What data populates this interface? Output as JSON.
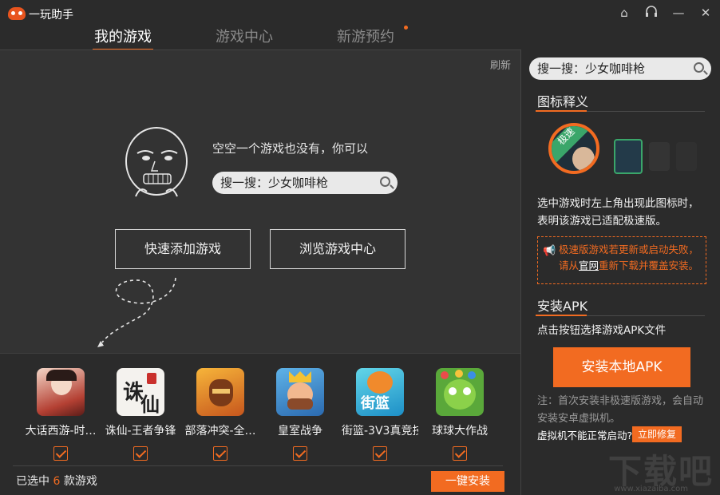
{
  "app": {
    "title": "一玩助手"
  },
  "tabs": [
    {
      "label": "我的游戏"
    },
    {
      "label": "游戏中心"
    },
    {
      "label": "新游预约"
    }
  ],
  "main": {
    "refresh": "刷新",
    "empty_text": "空空一个游戏也没有，你可以",
    "search_placeholder": "搜一搜：少女咖啡枪",
    "quick_add": "快速添加游戏",
    "browse_center": "浏览游戏中心"
  },
  "games": [
    {
      "name": "大话西游-时…",
      "checked": true
    },
    {
      "name": "诛仙-王者争锋",
      "checked": true
    },
    {
      "name": "部落冲突-全…",
      "checked": true
    },
    {
      "name": "皇室战争",
      "checked": true
    },
    {
      "name": "街篮-3V3真竞技",
      "checked": true
    },
    {
      "name": "球球大作战",
      "checked": true
    }
  ],
  "selection": {
    "prefix": "已选中",
    "count": "6",
    "suffix": "款游戏",
    "install_all": "一键安装"
  },
  "side": {
    "search_placeholder": "搜一搜：少女咖啡枪",
    "icon_legend_title": "图标释义",
    "speed_badge": "极速",
    "legend_desc": "选中游戏时左上角出现此图标时，表明该游戏已适配极速版。",
    "notice_line1": "极速版游戏若更新或启动失败，",
    "notice_line2_pre": "请从",
    "notice_link": "官网",
    "notice_line2_post": "重新下载并覆盖安装。",
    "apk_title": "安装APK",
    "apk_desc": "点击按钮选择游戏APK文件",
    "apk_button": "安装本地APK",
    "apk_note": "注：首次安装非极速版游戏，会自动安装安卓虚拟机。",
    "vm_question": "虚拟机不能正常启动?",
    "vm_repair": "立即修复"
  },
  "watermark": {
    "main": "下载吧",
    "sub": "www.xiazaiba.com"
  },
  "colors": {
    "accent": "#f26b21",
    "bg": "#2b2b2b",
    "main_bg": "#333333"
  }
}
